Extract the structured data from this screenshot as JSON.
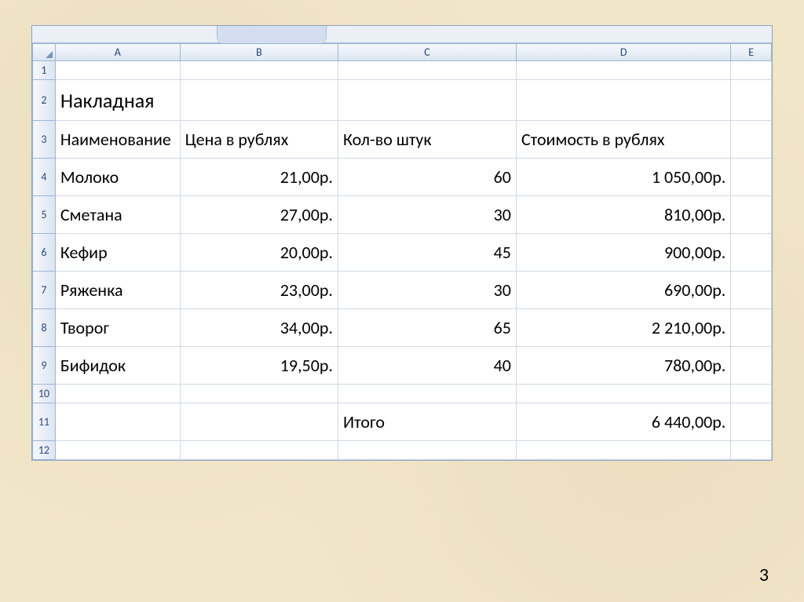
{
  "columns": {
    "a": "A",
    "b": "B",
    "c": "C",
    "d": "D",
    "e": "E"
  },
  "rows": {
    "r1": "1",
    "r2": "2",
    "r3": "3",
    "r4": "4",
    "r5": "5",
    "r6": "6",
    "r7": "7",
    "r8": "8",
    "r9": "9",
    "r10": "10",
    "r11": "11",
    "r12": "12"
  },
  "title": "Накладная",
  "headers": {
    "name": "Наименование",
    "price": "Цена в рублях",
    "qty": "Кол-во штук",
    "cost": "Стоимость в рублях"
  },
  "items": [
    {
      "name": "Молоко",
      "price": "21,00р.",
      "qty": "60",
      "cost": "1 050,00р."
    },
    {
      "name": "Сметана",
      "price": "27,00р.",
      "qty": "30",
      "cost": "810,00р."
    },
    {
      "name": "Кефир",
      "price": "20,00р.",
      "qty": "45",
      "cost": "900,00р."
    },
    {
      "name": "Ряженка",
      "price": "23,00р.",
      "qty": "30",
      "cost": "690,00р."
    },
    {
      "name": "Творог",
      "price": "34,00р.",
      "qty": "65",
      "cost": "2 210,00р."
    },
    {
      "name": "Бифидок",
      "price": "19,50р.",
      "qty": "40",
      "cost": "780,00р."
    }
  ],
  "total": {
    "label": "Итого",
    "value": "6 440,00р."
  },
  "page_number": "3"
}
